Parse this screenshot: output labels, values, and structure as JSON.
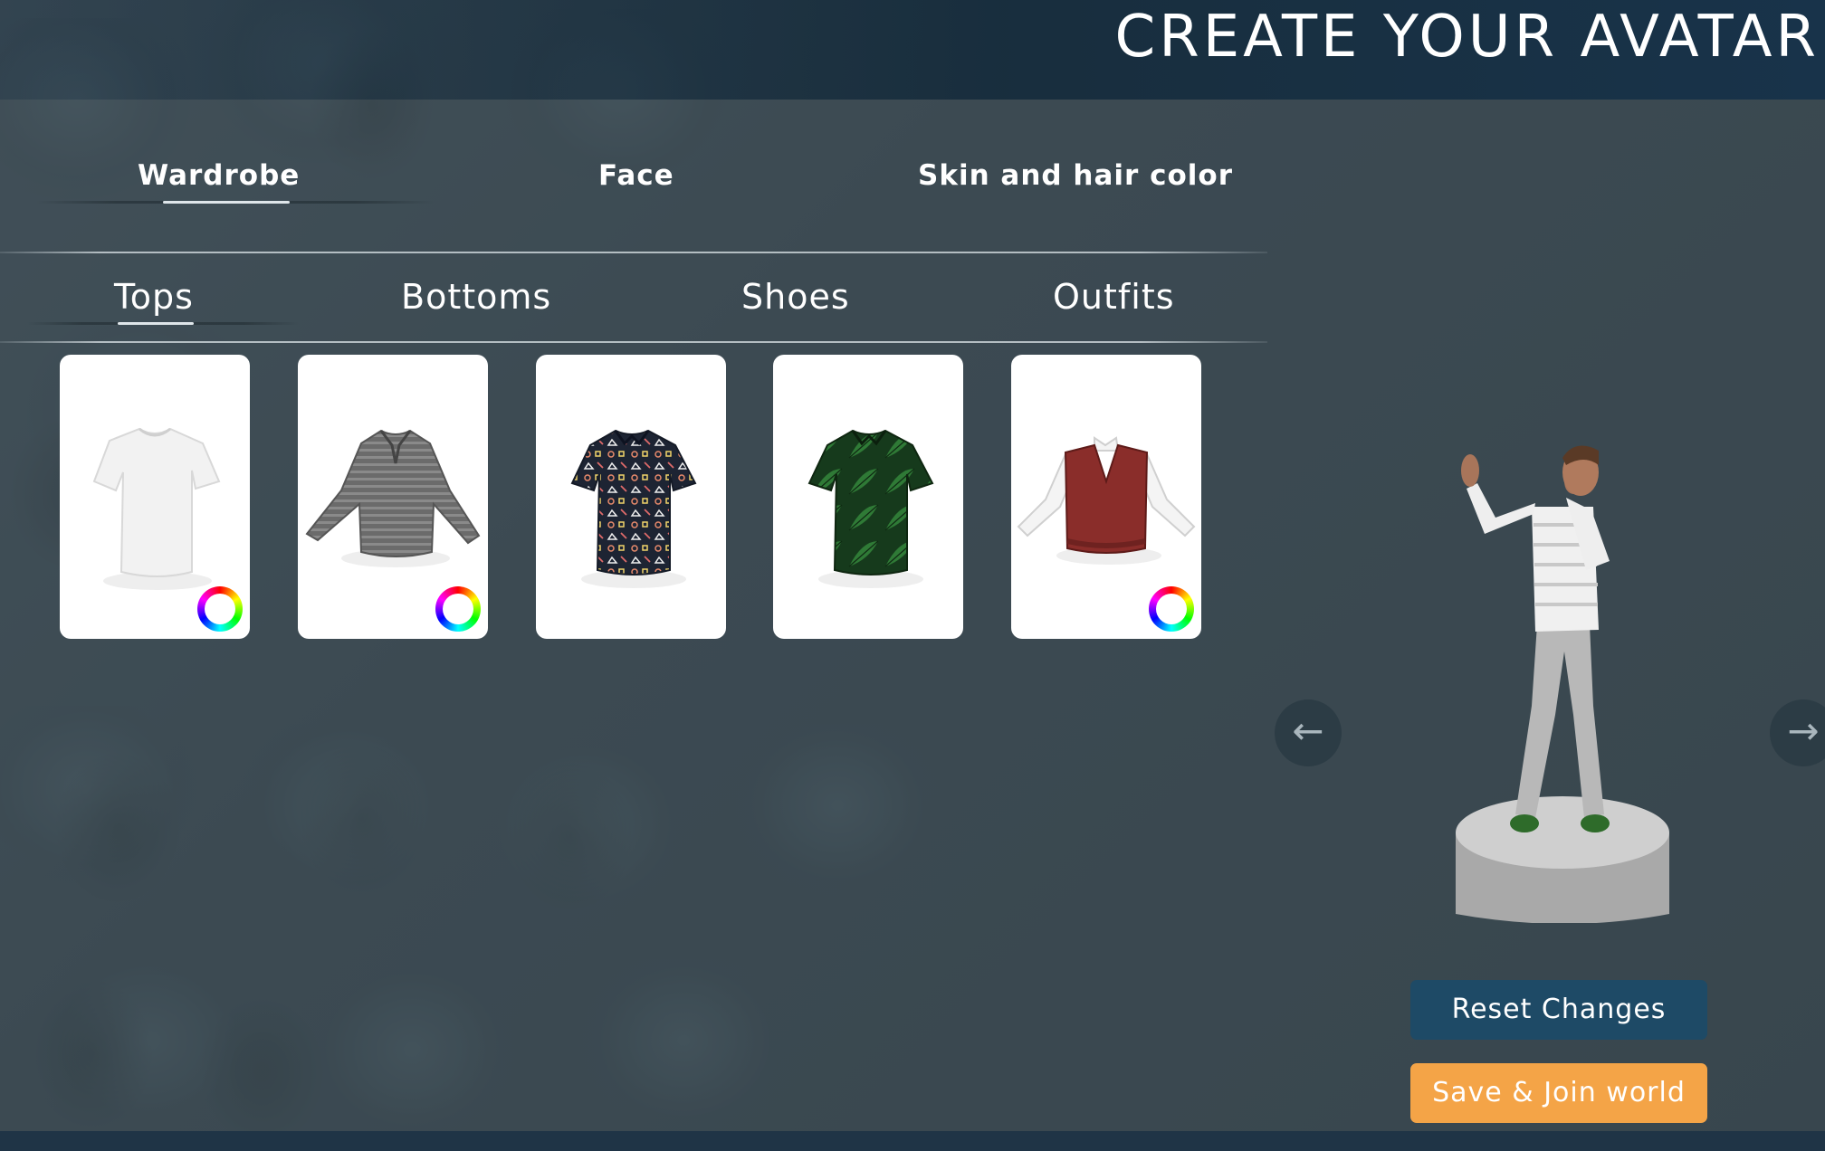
{
  "header": {
    "title": "CREATE YOUR AVATAR"
  },
  "main_tabs": [
    {
      "label": "Wardrobe",
      "active": true
    },
    {
      "label": "Face",
      "active": false
    },
    {
      "label": "Skin and hair color",
      "active": false
    }
  ],
  "sub_tabs": [
    {
      "label": "Tops",
      "active": true
    },
    {
      "label": "Bottoms",
      "active": false
    },
    {
      "label": "Shoes",
      "active": false
    },
    {
      "label": "Outfits",
      "active": false
    }
  ],
  "items": [
    {
      "name": "white-tshirt",
      "colorable": true
    },
    {
      "name": "grey-striped-sweater",
      "colorable": true
    },
    {
      "name": "patterned-shirt",
      "colorable": false
    },
    {
      "name": "green-leaf-shirt",
      "colorable": false
    },
    {
      "name": "red-vest-white-shirt",
      "colorable": true
    }
  ],
  "icons": {
    "prev": "arrow-left-icon",
    "next": "arrow-right-icon",
    "color": "color-wheel-icon"
  },
  "buttons": {
    "reset": "Reset Changes",
    "save": "Save & Join world"
  },
  "colors": {
    "accent_orange": "#f4a447",
    "reset_blue": "#1e4a66",
    "header_dark": "#18334a"
  }
}
